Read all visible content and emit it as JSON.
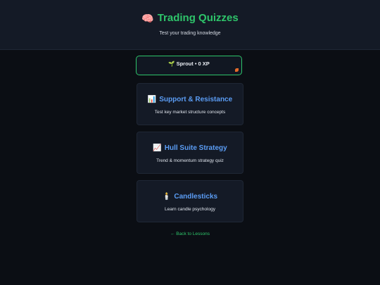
{
  "header": {
    "icon": "brain-icon",
    "icon_glyph": "🧠",
    "title": "Trading Quizzes",
    "subtitle": "Test your trading knowledge"
  },
  "xp": {
    "text": "🌱 Sprout • 0 XP",
    "corner_icon": "leaf-icon"
  },
  "quizzes": [
    {
      "icon": "bar-chart-icon",
      "icon_glyph": "📊",
      "title": "Support & Resistance",
      "description": "Test key market structure concepts"
    },
    {
      "icon": "trend-chart-icon",
      "icon_glyph": "📈",
      "title": "Hull Suite Strategy",
      "description": "Trend & momentum strategy quiz"
    },
    {
      "icon": "candle-icon",
      "icon_glyph": "🕯️",
      "title": "Candlesticks",
      "description": "Learn candle psychology"
    }
  ],
  "back_link": "← Back to Lessons",
  "colors": {
    "accent_green": "#2ec46a",
    "card_title_blue": "#5b9df5",
    "background": "#0b0e14",
    "card_bg": "#141a26"
  }
}
